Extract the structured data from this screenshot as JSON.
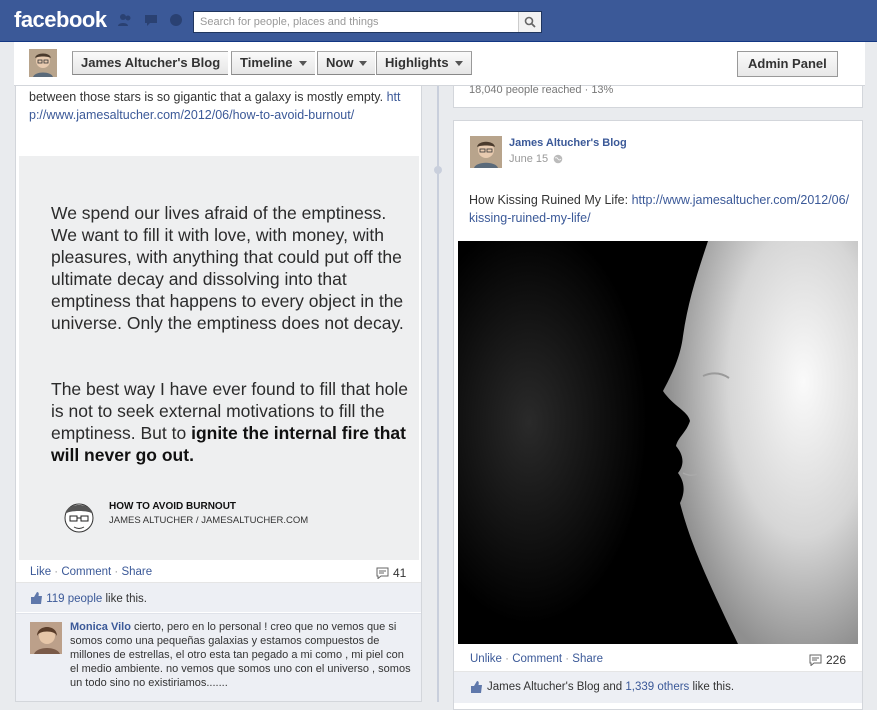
{
  "topbar": {
    "logo": "facebook",
    "search_placeholder": "Search for people, places and things"
  },
  "pagebar": {
    "page_name": "James Altucher's Blog",
    "tabs": [
      {
        "label": "Timeline"
      },
      {
        "label": "Now"
      },
      {
        "label": "Highlights"
      }
    ],
    "admin_label": "Admin Panel"
  },
  "left_post": {
    "text_prefix": "between those stars is so gigantic that a galaxy is mostly empty. ",
    "link": "http://www.jamesaltucher.com/2012/06/how-to-avoid-burnout/",
    "quote_p1": "We spend our lives afraid of the emptiness. We want to fill it with love, with money, with pleasures, with anything that could put off the ultimate decay and dissolving into that emptiness that happens to every object in the universe. Only the emptiness does not decay.",
    "quote_p2_normal": "The best way I have ever found to fill that hole is not to seek external motivations to fill the emptiness. But to ",
    "quote_p2_bold": "ignite the internal fire that will never go out.",
    "sig_title": "HOW TO AVOID BURNOUT",
    "sig_sub": "JAMES ALTUCHER / JAMESALTUCHER.COM",
    "actions": {
      "like": "Like",
      "comment": "Comment",
      "share": "Share"
    },
    "comment_count": "41",
    "likes_link": "119 people",
    "likes_suffix": " like this.",
    "comment": {
      "author": "Monica Vilo",
      "text": " cierto, pero en lo personal ! creo que no vemos que si somos como una pequeñas galaxias y estamos compuestos de millones de estrellas, el otro esta tan pegado a mi como , mi piel con el medio ambiente. no vemos que somos uno con el universo , somos un todo sino no existiriamos......."
    }
  },
  "right_top": {
    "reach": "18,040 people reached · 13%"
  },
  "right_post": {
    "author": "James Altucher's Blog",
    "date": "June 15",
    "text_prefix": "How Kissing Ruined My Life: ",
    "link": "http://www.jamesaltucher.com/2012/06/kissing-ruined-my-life/",
    "actions": {
      "unlike": "Unlike",
      "comment": "Comment",
      "share": "Share"
    },
    "comment_count": "226",
    "likes_name": "James Altucher's Blog",
    "likes_and": " and ",
    "likes_others": "1,339 others",
    "likes_suffix": " like this."
  },
  "colors": {
    "brand": "#3b5998",
    "link": "#3b5998",
    "ufi_bg": "#edeff4"
  }
}
